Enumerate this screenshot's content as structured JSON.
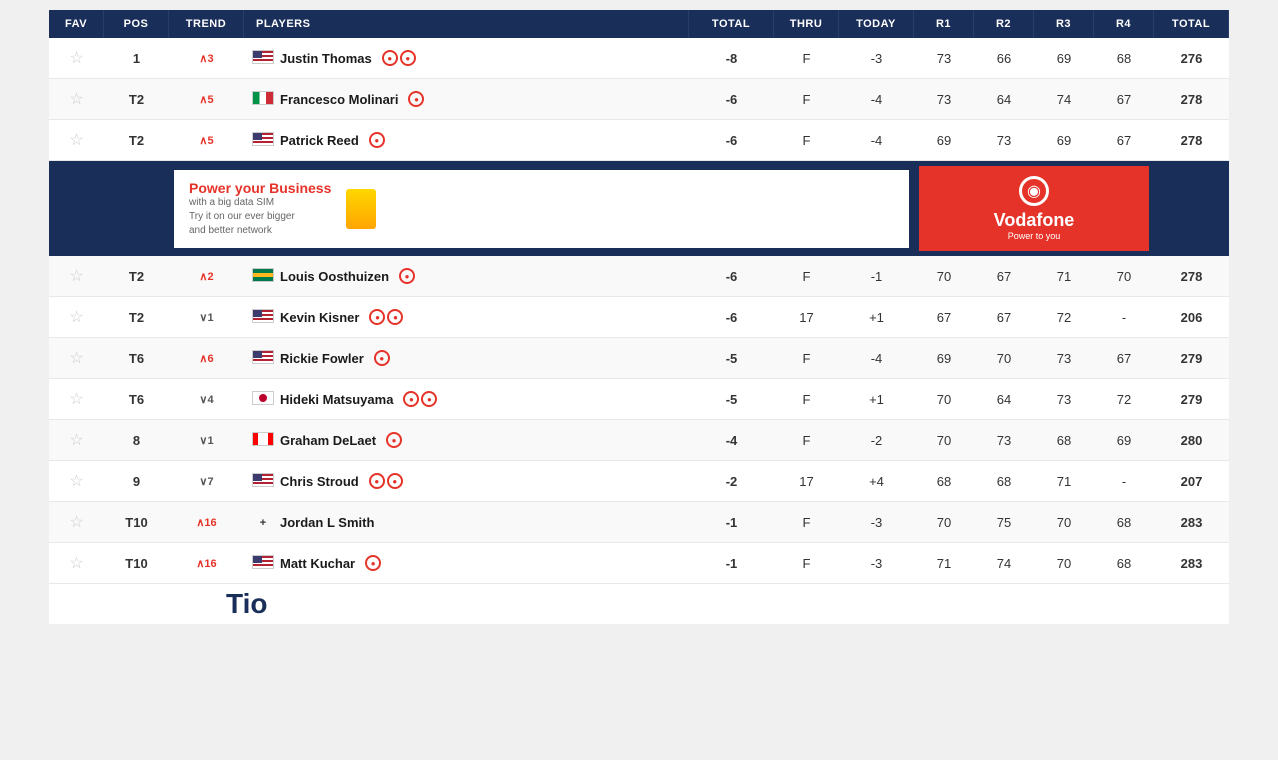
{
  "header": {
    "columns": [
      "FAV",
      "POS",
      "TREND",
      "PLAYERS",
      "TOTAL",
      "THRU",
      "TODAY",
      "R1",
      "R2",
      "R3",
      "R4",
      "TOTAL"
    ]
  },
  "players": [
    {
      "fav": "☆",
      "pos": "1",
      "trend": "up3",
      "trendLabel": "∧3",
      "flag": "usa",
      "name": "Justin Thomas",
      "icons": [
        "circle",
        "circle"
      ],
      "total": "-8",
      "thru": "F",
      "today": "-3",
      "r1": "73",
      "r2": "66",
      "r3": "69",
      "r4": "68",
      "totalScore": "276"
    },
    {
      "fav": "☆",
      "pos": "T2",
      "trend": "up5",
      "trendLabel": "∧5",
      "flag": "ita",
      "name": "Francesco Molinari",
      "icons": [
        "circle"
      ],
      "total": "-6",
      "thru": "F",
      "today": "-4",
      "r1": "73",
      "r2": "64",
      "r3": "74",
      "r4": "67",
      "totalScore": "278"
    },
    {
      "fav": "☆",
      "pos": "T2",
      "trend": "up5",
      "trendLabel": "∧5",
      "flag": "usa",
      "name": "Patrick Reed",
      "icons": [
        "circle"
      ],
      "total": "-6",
      "thru": "F",
      "today": "-4",
      "r1": "69",
      "r2": "73",
      "r3": "69",
      "r4": "67",
      "totalScore": "278"
    },
    {
      "fav": "☆",
      "pos": "T2",
      "trend": "up2",
      "trendLabel": "∧2",
      "flag": "rsa",
      "name": "Louis Oosthuizen",
      "icons": [
        "circle"
      ],
      "total": "-6",
      "thru": "F",
      "today": "-1",
      "r1": "70",
      "r2": "67",
      "r3": "71",
      "r4": "70",
      "totalScore": "278"
    },
    {
      "fav": "☆",
      "pos": "T2",
      "trend": "down1",
      "trendLabel": "∨1",
      "flag": "usa",
      "name": "Kevin Kisner",
      "icons": [
        "circle",
        "circle"
      ],
      "total": "-6",
      "thru": "17",
      "today": "+1",
      "r1": "67",
      "r2": "67",
      "r3": "72",
      "r4": "-",
      "totalScore": "206"
    },
    {
      "fav": "☆",
      "pos": "T6",
      "trend": "up6",
      "trendLabel": "∧6",
      "flag": "usa",
      "name": "Rickie Fowler",
      "icons": [
        "circle"
      ],
      "total": "-5",
      "thru": "F",
      "today": "-4",
      "r1": "69",
      "r2": "70",
      "r3": "73",
      "r4": "67",
      "totalScore": "279"
    },
    {
      "fav": "☆",
      "pos": "T6",
      "trend": "down4",
      "trendLabel": "∨4",
      "flag": "jpn",
      "name": "Hideki Matsuyama",
      "icons": [
        "circle",
        "circle"
      ],
      "total": "-5",
      "thru": "F",
      "today": "+1",
      "r1": "70",
      "r2": "64",
      "r3": "73",
      "r4": "72",
      "totalScore": "279"
    },
    {
      "fav": "☆",
      "pos": "8",
      "trend": "down1",
      "trendLabel": "∨1",
      "flag": "can",
      "name": "Graham DeLaet",
      "icons": [
        "circle"
      ],
      "total": "-4",
      "thru": "F",
      "today": "-2",
      "r1": "70",
      "r2": "73",
      "r3": "68",
      "r4": "69",
      "totalScore": "280"
    },
    {
      "fav": "☆",
      "pos": "9",
      "trend": "down7",
      "trendLabel": "∨7",
      "flag": "usa",
      "name": "Chris Stroud",
      "icons": [
        "circle",
        "circle"
      ],
      "total": "-2",
      "thru": "17",
      "today": "+4",
      "r1": "68",
      "r2": "68",
      "r3": "71",
      "r4": "-",
      "totalScore": "207"
    },
    {
      "fav": "☆",
      "pos": "T10",
      "trend": "up16",
      "trendLabel": "∧16",
      "flag": "cross",
      "name": "Jordan L Smith",
      "icons": [],
      "total": "-1",
      "thru": "F",
      "today": "-3",
      "r1": "70",
      "r2": "75",
      "r3": "70",
      "r4": "68",
      "totalScore": "283"
    },
    {
      "fav": "☆",
      "pos": "T10",
      "trend": "up16",
      "trendLabel": "∧16",
      "flag": "usa",
      "name": "Matt Kuchar",
      "icons": [
        "circle"
      ],
      "total": "-1",
      "thru": "F",
      "today": "-3",
      "r1": "71",
      "r2": "74",
      "r3": "70",
      "r4": "68",
      "totalScore": "283"
    }
  ],
  "ad": {
    "headline": "Power your Business",
    "line1": "with a big data SIM",
    "line2": "Try it on our ever bigger",
    "line3": "and better network",
    "brand": "Vodafone",
    "tagline": "Power to you"
  },
  "partial_text": "Tio"
}
